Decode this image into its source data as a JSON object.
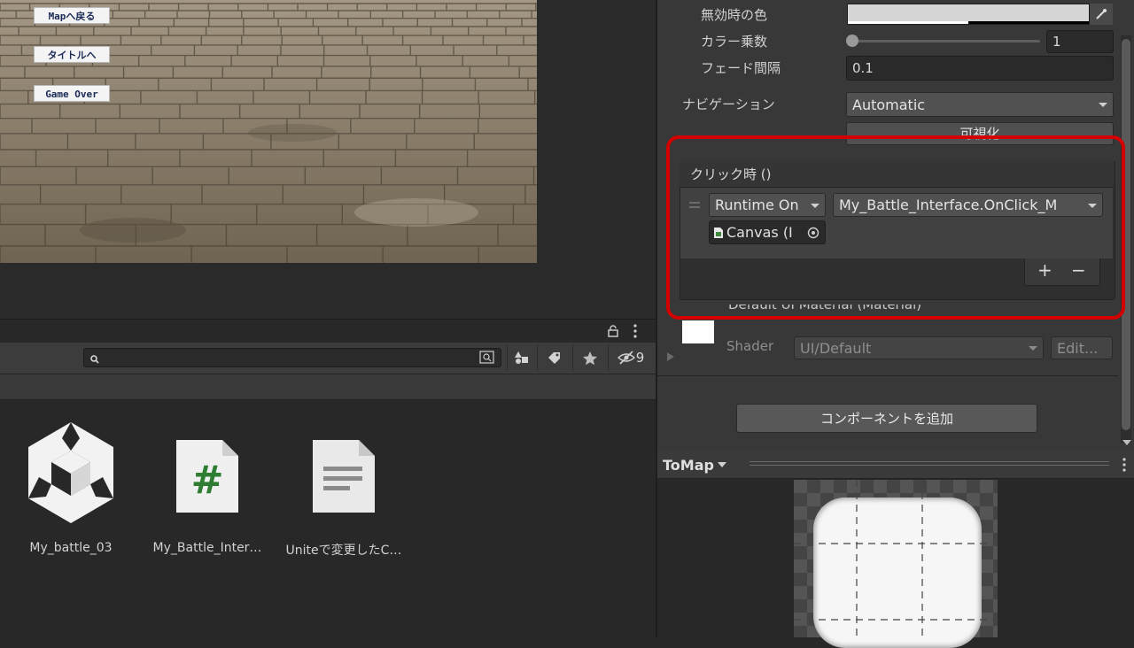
{
  "game_view": {
    "buttons": [
      "Mapへ戻る",
      "タイトルへ",
      "Game Over"
    ]
  },
  "project": {
    "search": {
      "value": "",
      "placeholder": ""
    },
    "hidden_count": "9",
    "assets": [
      {
        "label": "My_battle_03",
        "icon": "unity-logo-icon"
      },
      {
        "label": "My_Battle_Inter…",
        "icon": "csharp-script-icon"
      },
      {
        "label": "Uniteで変更したC…",
        "icon": "text-document-icon"
      }
    ]
  },
  "inspector": {
    "disabled_color_label": "無効時の色",
    "color_multiplier_label": "カラー乗数",
    "color_multiplier_value": "1",
    "fade_duration_label": "フェード間隔",
    "fade_duration_value": "0.1",
    "navigation_label": "ナビゲーション",
    "navigation_value": "Automatic",
    "visualize_label": "可視化",
    "on_click": {
      "title": "クリック時 ()",
      "runtime_mode": "Runtime On",
      "function": "My_Battle_Interface.OnClick_M",
      "target_object": "Canvas (I",
      "add_label": "+",
      "remove_label": "−"
    },
    "material": {
      "name": "Default UI Material (Material)",
      "shader_label": "Shader",
      "shader_value": "UI/Default",
      "edit_label": "Edit..."
    },
    "add_component_label": "コンポーネントを追加"
  },
  "preview": {
    "title": "ToMap"
  },
  "colors": {
    "highlight": "#d40000",
    "panel": "#383838"
  }
}
